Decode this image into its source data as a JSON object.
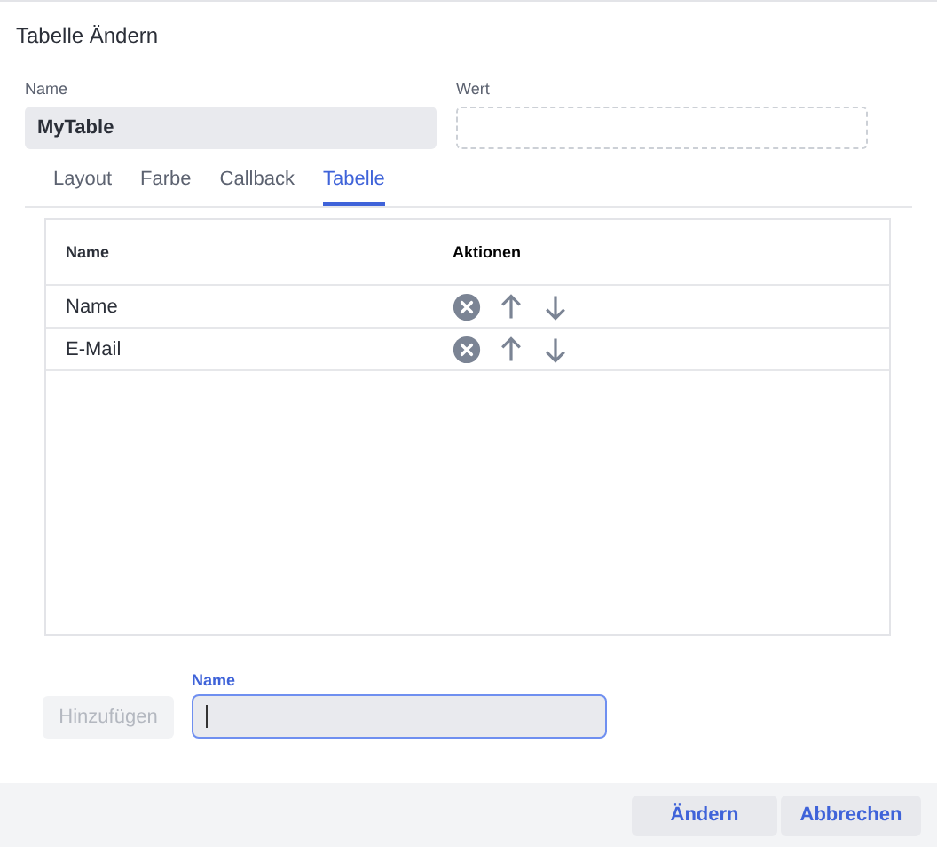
{
  "dialog": {
    "title": "Tabelle Ändern"
  },
  "fields": [
    {
      "label": "Name",
      "value": "MyTable"
    },
    {
      "label": "Wert"
    }
  ],
  "tabs": [
    {
      "label": "Layout",
      "selected": false
    },
    {
      "label": "Farbe",
      "selected": false
    },
    {
      "label": "Callback",
      "selected": false
    },
    {
      "label": "Tabelle",
      "selected": true
    }
  ],
  "table": {
    "columns": [
      "Name",
      "Aktionen"
    ],
    "rows": [
      {
        "name": "Name"
      },
      {
        "name": "E-Mail"
      }
    ]
  },
  "add": {
    "button": "Hinzufügen",
    "disabled": true,
    "field_label": "Name",
    "focused": true
  },
  "buttons": [
    "Ändern",
    "Abbrechen"
  ]
}
